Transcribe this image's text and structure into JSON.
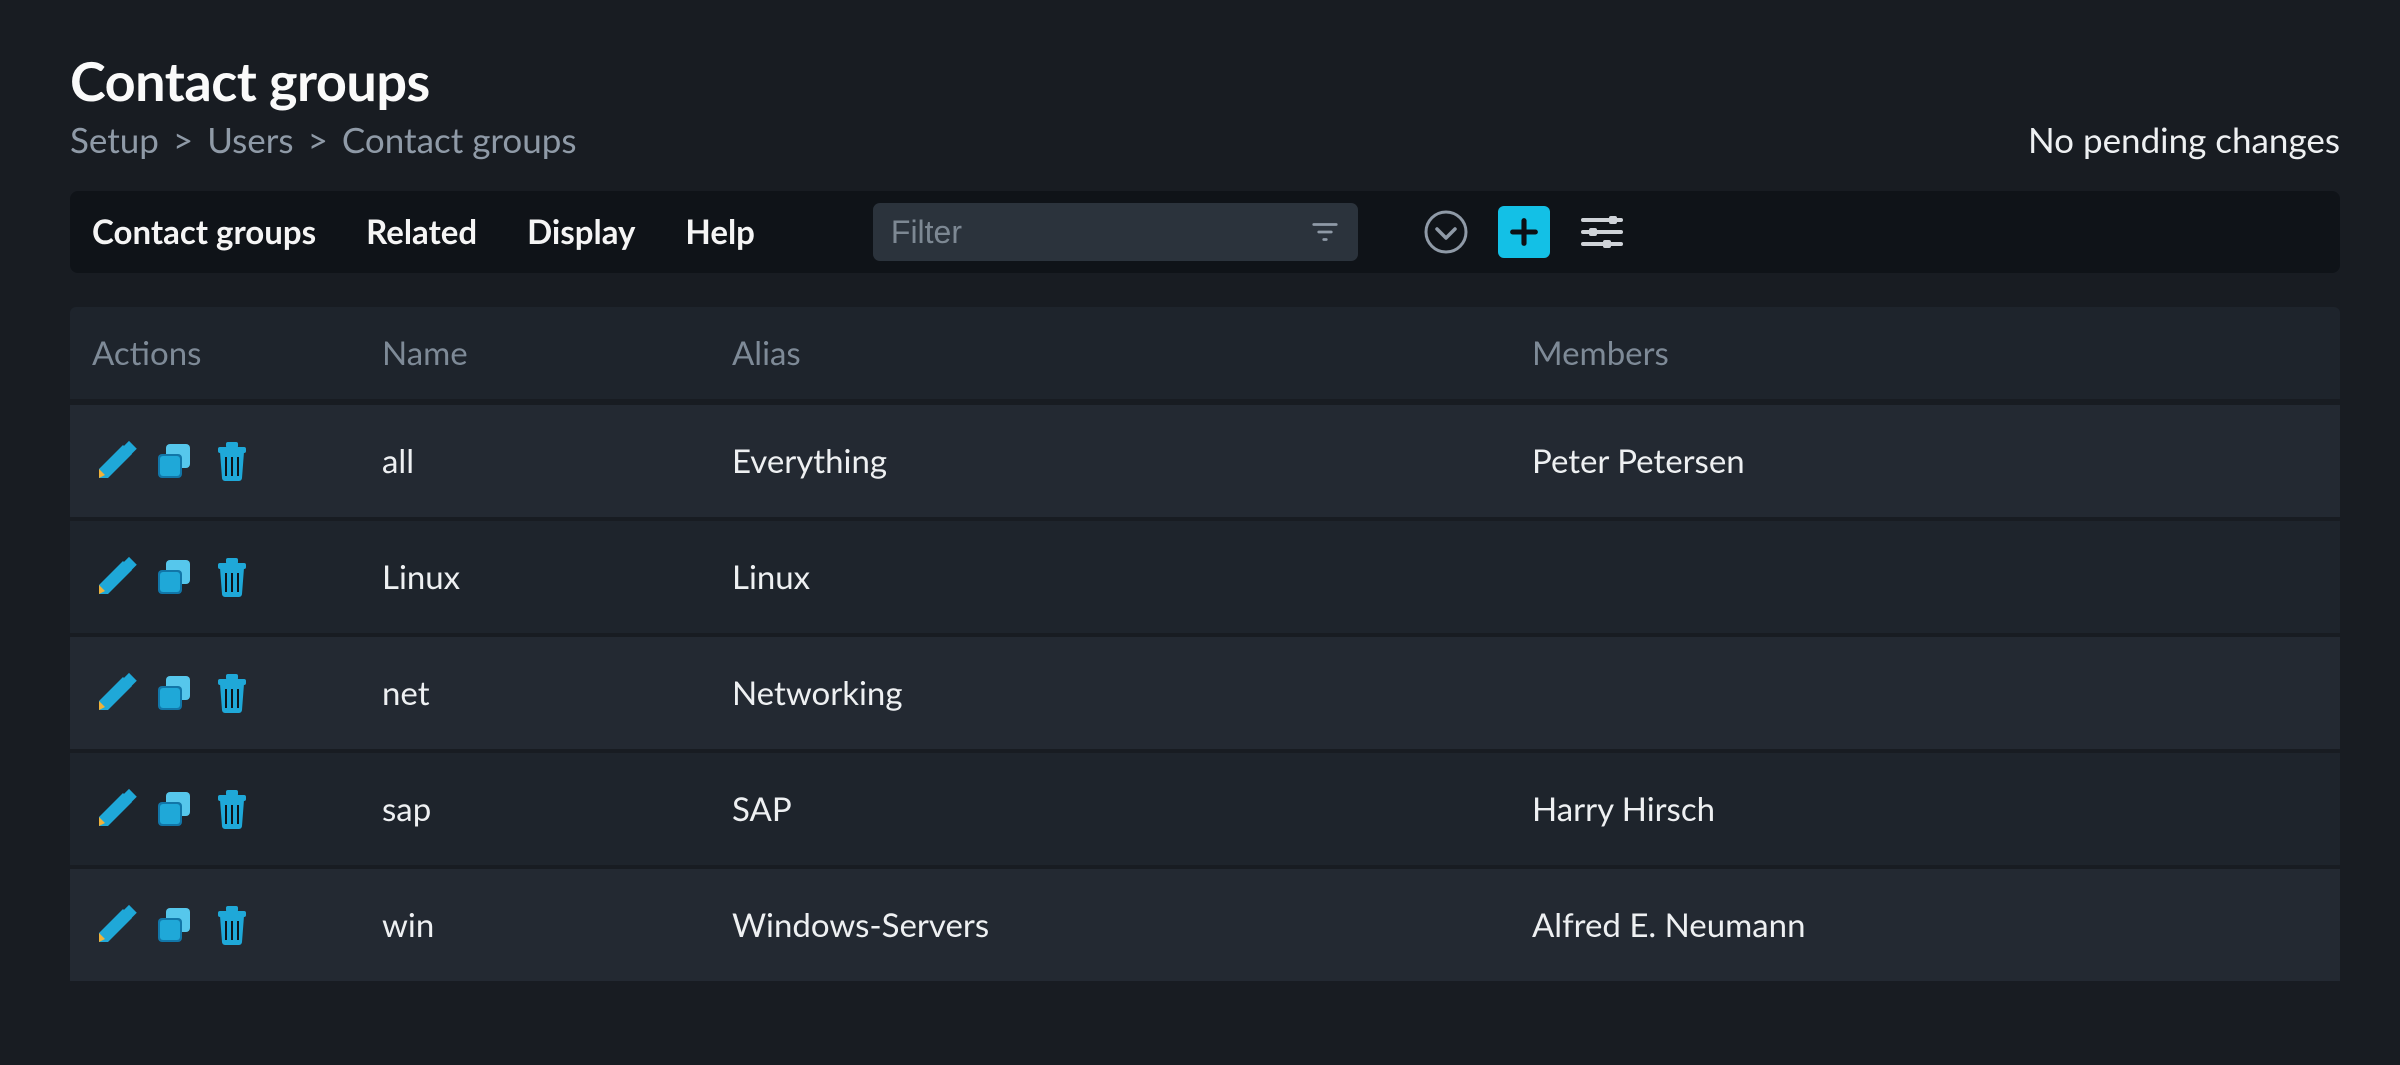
{
  "title": "Contact groups",
  "breadcrumbs": [
    "Setup",
    "Users",
    "Contact groups"
  ],
  "pending_status": "No pending changes",
  "toolbar": {
    "menus": {
      "contact_groups": "Contact groups",
      "related": "Related",
      "display": "Display",
      "help": "Help"
    },
    "filter_placeholder": "Filter"
  },
  "table": {
    "columns": {
      "actions": "Actions",
      "name": "Name",
      "alias": "Alias",
      "members": "Members"
    },
    "rows": [
      {
        "name": "all",
        "alias": "Everything",
        "members": "Peter Petersen"
      },
      {
        "name": "Linux",
        "alias": "Linux",
        "members": ""
      },
      {
        "name": "net",
        "alias": "Networking",
        "members": ""
      },
      {
        "name": "sap",
        "alias": "SAP",
        "members": "Harry Hirsch"
      },
      {
        "name": "win",
        "alias": "Windows-Servers",
        "members": "Alfred E. Neumann"
      }
    ]
  },
  "colors": {
    "accent": "#13c0e6",
    "icon_blue": "#1fa8d8",
    "pencil_tip": "#f0b23a"
  }
}
